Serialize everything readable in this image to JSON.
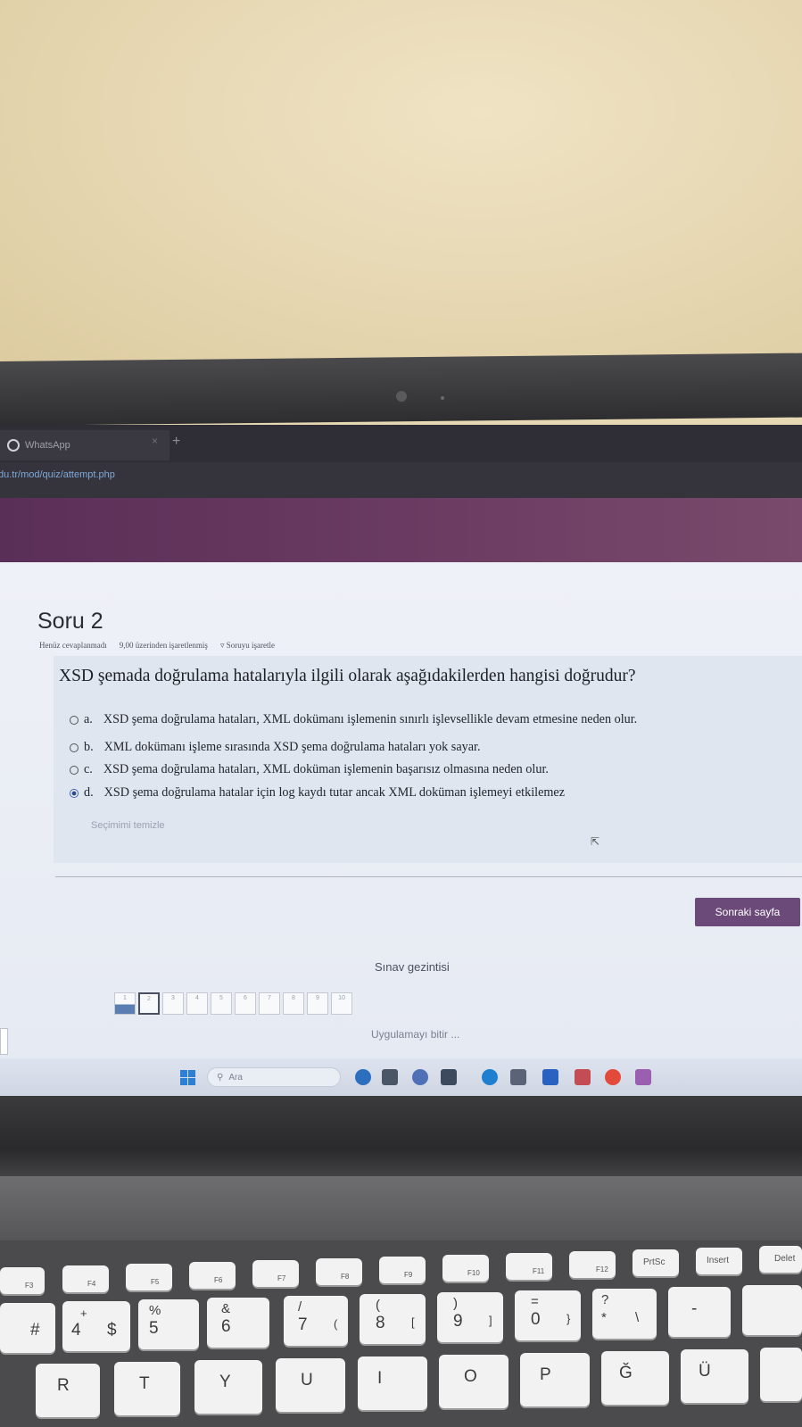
{
  "browser": {
    "tab_title": "WhatsApp",
    "tab_close": "×",
    "new_tab": "+",
    "url": "du.tr/mod/quiz/attempt.php"
  },
  "quiz": {
    "question_title": "Soru 2",
    "status": "Henüz cevaplanmadı",
    "mark": "9,00 üzerinden işaretlenmiş",
    "flag": "Soruyu işaretle",
    "question_text": "XSD şemada doğrulama hatalarıyla ilgili olarak aşağıdakilerden hangisi doğrudur?",
    "options": [
      {
        "letter": "a.",
        "text": "XSD şema doğrulama hataları, XML dokümanı işlemenin sınırlı işlevsellikle devam etmesine neden olur.",
        "selected": false
      },
      {
        "letter": "b.",
        "text": "XML dokümanı işleme sırasında XSD şema doğrulama hataları yok sayar.",
        "selected": false
      },
      {
        "letter": "c.",
        "text": "XSD şema doğrulama hataları, XML doküman işlemenin başarısız olmasına neden olur.",
        "selected": false
      },
      {
        "letter": "d.",
        "text": "XSD şema doğrulama hatalar için log kaydı tutar ancak XML doküman işlemeyi etkilemez",
        "selected": true
      }
    ],
    "clear_choice": "Seçimimi temizle",
    "next_page": "Sonraki sayfa"
  },
  "navigation": {
    "title": "Sınav gezintisi",
    "questions": [
      "1",
      "2",
      "3",
      "4",
      "5",
      "6",
      "7",
      "8",
      "9",
      "10"
    ],
    "answered": [
      "1"
    ],
    "current": "2",
    "finish": "Uygulamayı bitir ..."
  },
  "taskbar": {
    "search_placeholder": "Ara"
  },
  "keyboard": {
    "fn_row": [
      "F3",
      "F4",
      "F5",
      "F6",
      "F7",
      "F8",
      "F9",
      "F10",
      "F11",
      "F12",
      "PrtSc",
      "Insert",
      "Delet"
    ],
    "number_row": [
      {
        "main": "#",
        "shift": ""
      },
      {
        "main": "4",
        "shift": "+"
      },
      {
        "main": "$",
        "shift": ""
      },
      {
        "main": "5",
        "shift": "%"
      },
      {
        "main": "6",
        "shift": "&"
      },
      {
        "main": "7",
        "shift": "/"
      },
      {
        "main": "(",
        "shift": ""
      },
      {
        "main": "8",
        "shift": "("
      },
      {
        "main": "[",
        "shift": ""
      },
      {
        "main": "9",
        "shift": ")"
      },
      {
        "main": "]",
        "shift": ""
      },
      {
        "main": "0",
        "shift": "="
      },
      {
        "main": "}",
        "shift": ""
      },
      {
        "main": "*",
        "shift": "?"
      },
      {
        "main": "\\",
        "shift": ""
      },
      {
        "main": "-",
        "shift": ""
      }
    ],
    "letter_row": [
      "R",
      "T",
      "Y",
      "U",
      "I",
      "O",
      "P",
      "Ğ",
      "Ü"
    ]
  },
  "colors": {
    "purple_header": "#6a3a62",
    "next_button": "#6b4a7a",
    "page_bg": "#eef1f7",
    "wall": "#e8d9b5"
  }
}
